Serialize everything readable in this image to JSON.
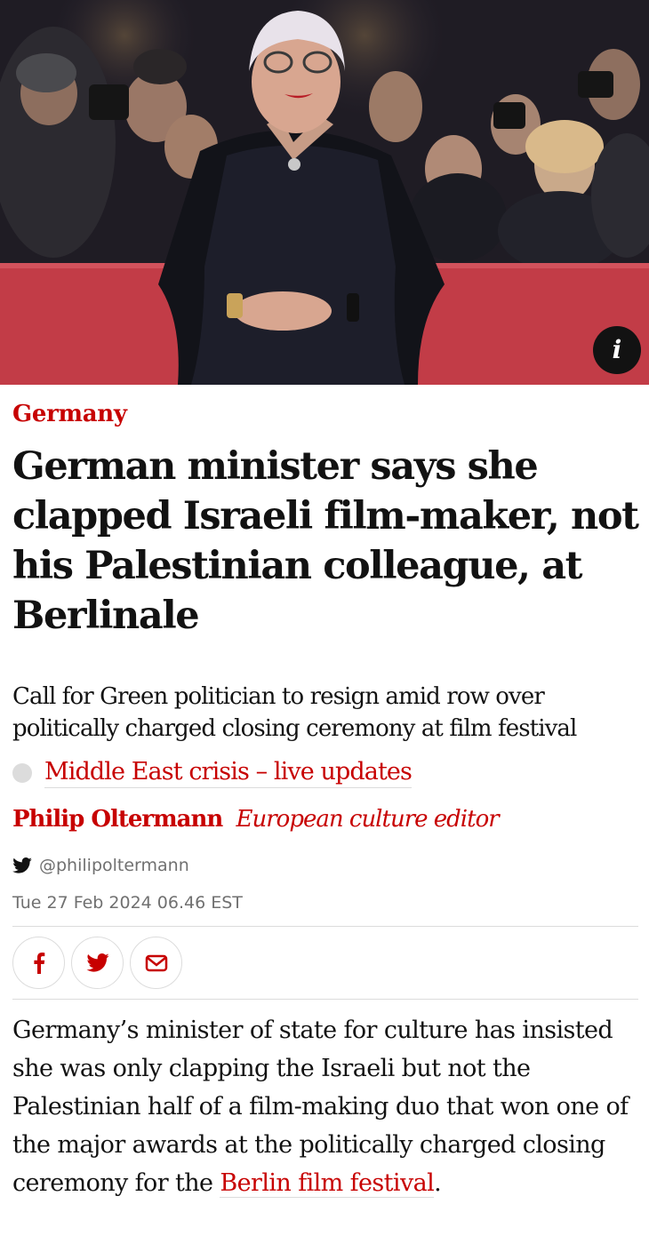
{
  "hero": {
    "info_label": "i"
  },
  "article": {
    "kicker": "Germany",
    "headline": "German minister says she clapped Israeli film-maker, not his Palestinian colleague, at Berlinale",
    "standfirst": "Call for Green politician to resign amid row over politically charged closing ceremony at film festival",
    "live_link": "Middle East crisis – live updates",
    "author_name": "Philip Oltermann",
    "author_role": "European culture editor",
    "twitter_handle": "@philipoltermann",
    "date": "Tue 27 Feb 2024 06.46 EST",
    "share_buttons": [
      "facebook-icon",
      "twitter-icon",
      "email-icon"
    ],
    "body_text": "Germany’s minister of state for culture has insisted she was only clapping the Israeli but not the Palestinian half of a film-making duo that won one of the major awards at the politically charged closing ceremony for the ",
    "body_link": "Berlin film festival",
    "body_end": "."
  },
  "colors": {
    "accent": "#c70000",
    "text": "#121212",
    "muted": "#707070",
    "rule": "#dcdcdc"
  }
}
